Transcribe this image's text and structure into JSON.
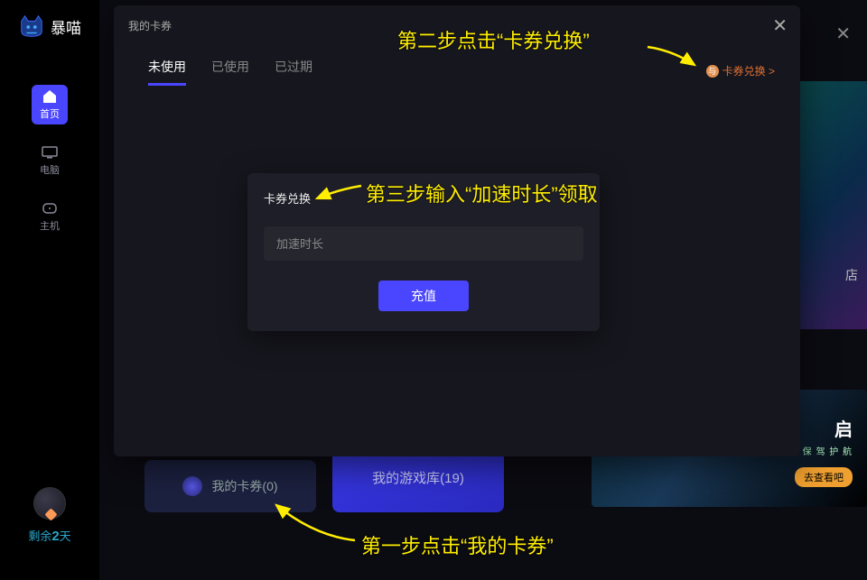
{
  "brand": "暴喵",
  "sidebar": {
    "items": [
      {
        "label": "首页"
      },
      {
        "label": "电脑"
      },
      {
        "label": "主机"
      }
    ],
    "remain_prefix": "剩余",
    "remain_value": "2",
    "remain_suffix": "天"
  },
  "main": {
    "my_cards_label": "我的卡券(0)",
    "my_library_label": "我的游戏库(19)",
    "promo1_suffix": "店",
    "promo2_title": "启",
    "promo2_sub": "暴 喵 专 业 加 速   为 你 保 驾 护 航",
    "promo2_btn": "去查看吧"
  },
  "modal": {
    "title": "我的卡券",
    "tabs": [
      {
        "label": "未使用"
      },
      {
        "label": "已使用"
      },
      {
        "label": "已过期"
      }
    ],
    "exchange_label": "卡券兑换 >",
    "coin_symbol": "与"
  },
  "inner_modal": {
    "title": "卡券兑换",
    "placeholder": "加速时长",
    "button": "充值"
  },
  "annotations": {
    "step1": "第一步点击“我的卡券”",
    "step2": "第二步点击“卡券兑换”",
    "step3": "第三步输入“加速时长”领取"
  }
}
